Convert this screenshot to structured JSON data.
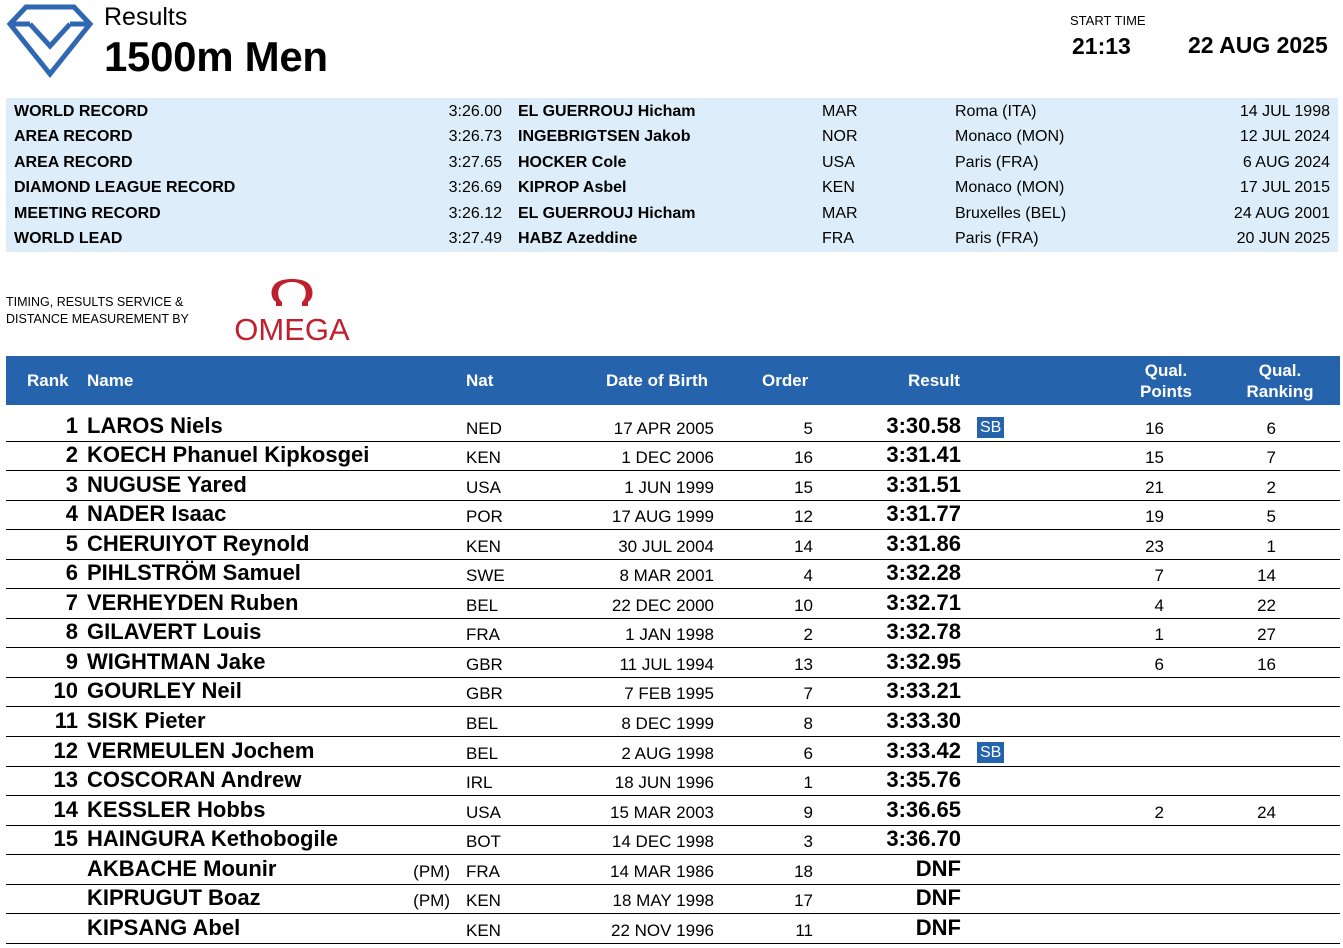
{
  "header": {
    "results_label": "Results",
    "event_title": "1500m Men",
    "start_time_label": "START TIME",
    "start_time": "21:13",
    "date": "22 AUG 2025"
  },
  "records": [
    {
      "type": "WORLD RECORD",
      "mark": "3:26.00",
      "name": "EL GUERROUJ Hicham",
      "nat": "MAR",
      "venue": "Roma (ITA)",
      "date": "14 JUL 1998"
    },
    {
      "type": "AREA RECORD",
      "mark": "3:26.73",
      "name": "INGEBRIGTSEN Jakob",
      "nat": "NOR",
      "venue": "Monaco (MON)",
      "date": "12 JUL 2024"
    },
    {
      "type": "AREA RECORD",
      "mark": "3:27.65",
      "name": "HOCKER Cole",
      "nat": "USA",
      "venue": "Paris (FRA)",
      "date": "6 AUG 2024"
    },
    {
      "type": "DIAMOND LEAGUE RECORD",
      "mark": "3:26.69",
      "name": "KIPROP Asbel",
      "nat": "KEN",
      "venue": "Monaco (MON)",
      "date": "17 JUL 2015"
    },
    {
      "type": "MEETING RECORD",
      "mark": "3:26.12",
      "name": "EL GUERROUJ Hicham",
      "nat": "MAR",
      "venue": "Bruxelles (BEL)",
      "date": "24 AUG 2001"
    },
    {
      "type": "WORLD LEAD",
      "mark": "3:27.49",
      "name": "HABZ Azeddine",
      "nat": "FRA",
      "venue": "Paris (FRA)",
      "date": "20 JUN 2025"
    }
  ],
  "timing": {
    "line1": "TIMING, RESULTS SERVICE &",
    "line2": "DISTANCE MEASUREMENT BY",
    "brand": "OMEGA"
  },
  "columns": {
    "rank": "Rank",
    "name": "Name",
    "nat": "Nat",
    "dob": "Date of Birth",
    "order": "Order",
    "result": "Result",
    "qual_points_1": "Qual.",
    "qual_points_2": "Points",
    "qual_ranking_1": "Qual.",
    "qual_ranking_2": "Ranking"
  },
  "results": [
    {
      "rank": "1",
      "name": "LAROS Niels",
      "pm": "",
      "nat": "NED",
      "dob": "17 APR 2005",
      "order": "5",
      "result": "3:30.58",
      "badge": "SB",
      "qual_points": "16",
      "qual_ranking": "6"
    },
    {
      "rank": "2",
      "name": "KOECH Phanuel Kipkosgei",
      "pm": "",
      "nat": "KEN",
      "dob": "1 DEC 2006",
      "order": "16",
      "result": "3:31.41",
      "badge": "",
      "qual_points": "15",
      "qual_ranking": "7"
    },
    {
      "rank": "3",
      "name": "NUGUSE Yared",
      "pm": "",
      "nat": "USA",
      "dob": "1 JUN 1999",
      "order": "15",
      "result": "3:31.51",
      "badge": "",
      "qual_points": "21",
      "qual_ranking": "2"
    },
    {
      "rank": "4",
      "name": "NADER Isaac",
      "pm": "",
      "nat": "POR",
      "dob": "17 AUG 1999",
      "order": "12",
      "result": "3:31.77",
      "badge": "",
      "qual_points": "19",
      "qual_ranking": "5"
    },
    {
      "rank": "5",
      "name": "CHERUIYOT Reynold",
      "pm": "",
      "nat": "KEN",
      "dob": "30 JUL 2004",
      "order": "14",
      "result": "3:31.86",
      "badge": "",
      "qual_points": "23",
      "qual_ranking": "1"
    },
    {
      "rank": "6",
      "name": "PIHLSTRÖM Samuel",
      "pm": "",
      "nat": "SWE",
      "dob": "8 MAR 2001",
      "order": "4",
      "result": "3:32.28",
      "badge": "",
      "qual_points": "7",
      "qual_ranking": "14"
    },
    {
      "rank": "7",
      "name": "VERHEYDEN Ruben",
      "pm": "",
      "nat": "BEL",
      "dob": "22 DEC 2000",
      "order": "10",
      "result": "3:32.71",
      "badge": "",
      "qual_points": "4",
      "qual_ranking": "22"
    },
    {
      "rank": "8",
      "name": "GILAVERT Louis",
      "pm": "",
      "nat": "FRA",
      "dob": "1 JAN 1998",
      "order": "2",
      "result": "3:32.78",
      "badge": "",
      "qual_points": "1",
      "qual_ranking": "27"
    },
    {
      "rank": "9",
      "name": "WIGHTMAN Jake",
      "pm": "",
      "nat": "GBR",
      "dob": "11 JUL 1994",
      "order": "13",
      "result": "3:32.95",
      "badge": "",
      "qual_points": "6",
      "qual_ranking": "16"
    },
    {
      "rank": "10",
      "name": "GOURLEY Neil",
      "pm": "",
      "nat": "GBR",
      "dob": "7 FEB 1995",
      "order": "7",
      "result": "3:33.21",
      "badge": "",
      "qual_points": "",
      "qual_ranking": ""
    },
    {
      "rank": "11",
      "name": "SISK Pieter",
      "pm": "",
      "nat": "BEL",
      "dob": "8 DEC 1999",
      "order": "8",
      "result": "3:33.30",
      "badge": "",
      "qual_points": "",
      "qual_ranking": ""
    },
    {
      "rank": "12",
      "name": "VERMEULEN Jochem",
      "pm": "",
      "nat": "BEL",
      "dob": "2 AUG 1998",
      "order": "6",
      "result": "3:33.42",
      "badge": "SB",
      "qual_points": "",
      "qual_ranking": ""
    },
    {
      "rank": "13",
      "name": "COSCORAN Andrew",
      "pm": "",
      "nat": "IRL",
      "dob": "18 JUN 1996",
      "order": "1",
      "result": "3:35.76",
      "badge": "",
      "qual_points": "",
      "qual_ranking": ""
    },
    {
      "rank": "14",
      "name": "KESSLER Hobbs",
      "pm": "",
      "nat": "USA",
      "dob": "15 MAR 2003",
      "order": "9",
      "result": "3:36.65",
      "badge": "",
      "qual_points": "2",
      "qual_ranking": "24"
    },
    {
      "rank": "15",
      "name": "HAINGURA Kethobogile",
      "pm": "",
      "nat": "BOT",
      "dob": "14 DEC 1998",
      "order": "3",
      "result": "3:36.70",
      "badge": "",
      "qual_points": "",
      "qual_ranking": ""
    },
    {
      "rank": "",
      "name": "AKBACHE Mounir",
      "pm": "(PM)",
      "nat": "FRA",
      "dob": "14 MAR 1986",
      "order": "18",
      "result": "DNF",
      "badge": "",
      "qual_points": "",
      "qual_ranking": ""
    },
    {
      "rank": "",
      "name": "KIPRUGUT Boaz",
      "pm": "(PM)",
      "nat": "KEN",
      "dob": "18 MAY 1998",
      "order": "17",
      "result": "DNF",
      "badge": "",
      "qual_points": "",
      "qual_ranking": ""
    },
    {
      "rank": "",
      "name": "KIPSANG Abel",
      "pm": "",
      "nat": "KEN",
      "dob": "22 NOV 1996",
      "order": "11",
      "result": "DNF",
      "badge": "",
      "qual_points": "",
      "qual_ranking": ""
    }
  ],
  "colors": {
    "header_blue": "#2563ad",
    "records_bg": "#ddeefa",
    "logo_blue": "#2f67b2",
    "omega_red": "#c0202e"
  }
}
